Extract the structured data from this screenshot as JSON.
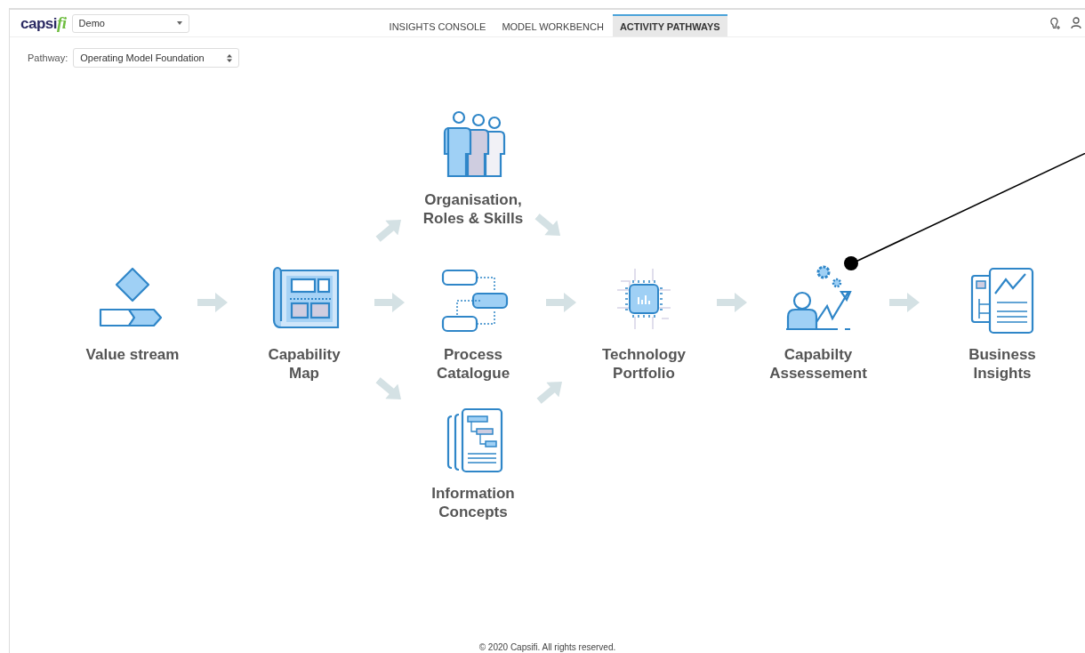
{
  "header": {
    "logo": {
      "main": "capsi",
      "accent": "fi"
    },
    "project_select": {
      "value": "Demo"
    },
    "tabs": [
      {
        "label": "INSIGHTS CONSOLE",
        "selected": false
      },
      {
        "label": "MODEL WORKBENCH",
        "selected": false
      },
      {
        "label": "ACTIVITY PATHWAYS",
        "selected": true
      }
    ]
  },
  "pathway": {
    "label": "Pathway:",
    "value": "Operating Model Foundation"
  },
  "nodes": [
    {
      "kind": "value-stream",
      "label": "Value stream"
    },
    {
      "kind": "capability-map",
      "label": "Capability\nMap"
    },
    {
      "kind": "org",
      "label": "Organisation,\nRoles & Skills"
    },
    {
      "kind": "process",
      "label": "Process\nCatalogue"
    },
    {
      "kind": "info",
      "label": "Information\nConcepts"
    },
    {
      "kind": "tech",
      "label": "Technology\nPortfolio"
    },
    {
      "kind": "assessment",
      "label": "Capabilty\nAssessement"
    },
    {
      "kind": "insights",
      "label": "Business\nInsights"
    }
  ],
  "footer": "© 2020 Capsifi. All rights reserved."
}
